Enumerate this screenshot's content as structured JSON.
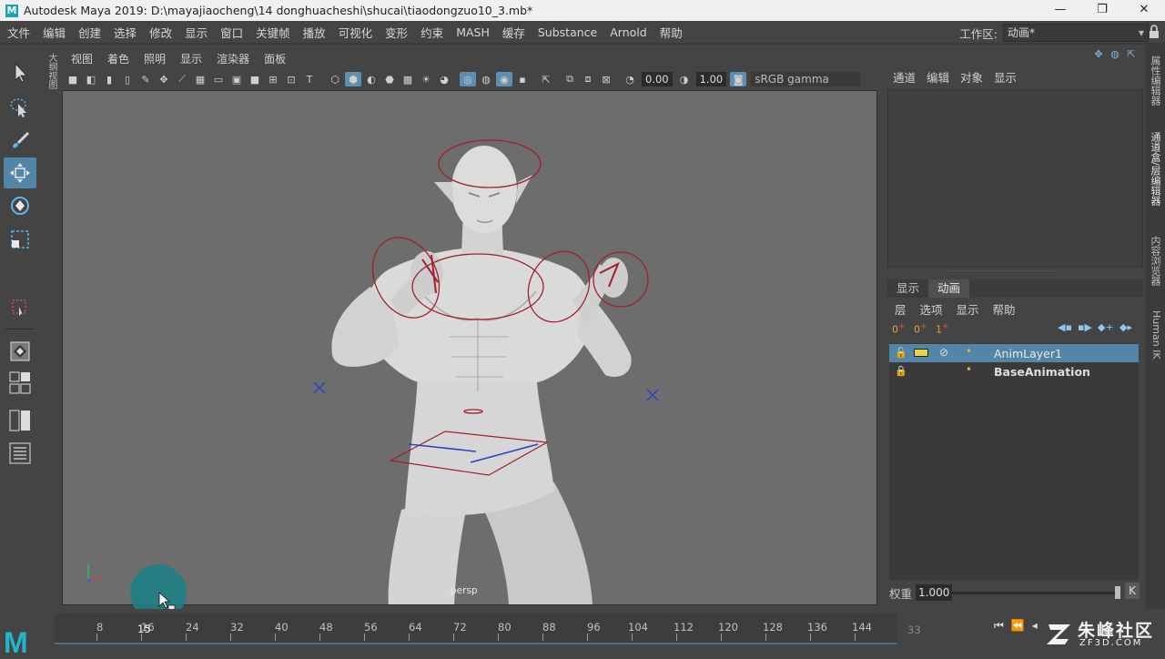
{
  "window": {
    "title": "Autodesk Maya 2019: D:\\mayajiaocheng\\14 donghuacheshi\\shucai\\tiaodongzuo10_3.mb*",
    "logo_letter": "M",
    "minimize": "—",
    "maximize": "❐",
    "close": "✕"
  },
  "menubar": {
    "items": [
      "文件",
      "编辑",
      "创建",
      "选择",
      "修改",
      "显示",
      "窗口",
      "关键帧",
      "播放",
      "可视化",
      "变形",
      "约束",
      "MASH",
      "缓存",
      "Substance",
      "Arnold",
      "帮助"
    ]
  },
  "workspace": {
    "label": "工作区:",
    "value": "动画*"
  },
  "outliner_tab": "大纲视图",
  "viewport": {
    "menu": [
      "视图",
      "着色",
      "照明",
      "显示",
      "渲染器",
      "面板"
    ],
    "exposure": "0.00",
    "gamma": "1.00",
    "colorspace": "sRGB gamma",
    "camera_label": "persp"
  },
  "channel_box": {
    "menu": [
      "通道",
      "编辑",
      "对象",
      "显示"
    ]
  },
  "layer_editor": {
    "tabs": [
      "显示",
      "动画"
    ],
    "active_tab": "动画",
    "menu": [
      "层",
      "选项",
      "显示",
      "帮助"
    ],
    "icon_labels": [
      "0",
      "0",
      "1"
    ],
    "layers": [
      {
        "name": "AnimLayer1",
        "selected": true
      },
      {
        "name": "BaseAnimation",
        "selected": false
      }
    ],
    "weight_label": "权重",
    "weight_value": "1.000",
    "key_button": "K"
  },
  "side_tabs": [
    "属性编辑器",
    "通道盒/层编辑器",
    "内容浏览器",
    "Human IK"
  ],
  "timeline": {
    "ticks": [
      "8",
      "16",
      "24",
      "32",
      "40",
      "48",
      "56",
      "64",
      "72",
      "80",
      "88",
      "96",
      "104",
      "112",
      "120",
      "128",
      "136",
      "144"
    ],
    "current_frame": "15",
    "frame_field": "33",
    "transport": [
      "⏮",
      "⏪",
      "◂"
    ]
  },
  "watermark": {
    "cn": "朱峰社区",
    "en": "ZF3D.COM"
  },
  "colors": {
    "accent": "#5285a6",
    "viewport_bg": "#6d6d6d",
    "rig_control": "#a0202c",
    "rig_blue": "#3040c0",
    "maya_cyan": "#25b5c8"
  }
}
